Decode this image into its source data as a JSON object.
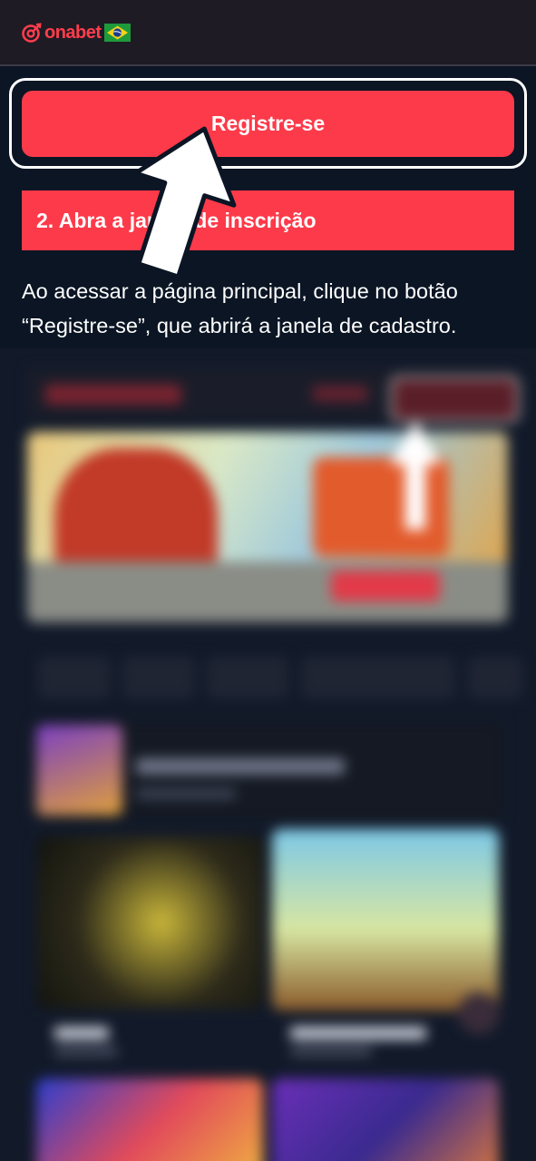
{
  "header": {
    "logo_text": "onabet",
    "flag": "brazil-flag"
  },
  "register_button": {
    "label": "Registre-se"
  },
  "step": {
    "title": "2. Abra a janela de inscrição",
    "description": "Ao acessar a página principal, clique no botão “Registre-se”, que abrirá a janela de cadastro."
  },
  "colors": {
    "accent": "#fd3a4a",
    "background": "#0b1524",
    "topbar": "#1e1b24"
  },
  "icons": {
    "pointer": "arrow-up-icon"
  }
}
